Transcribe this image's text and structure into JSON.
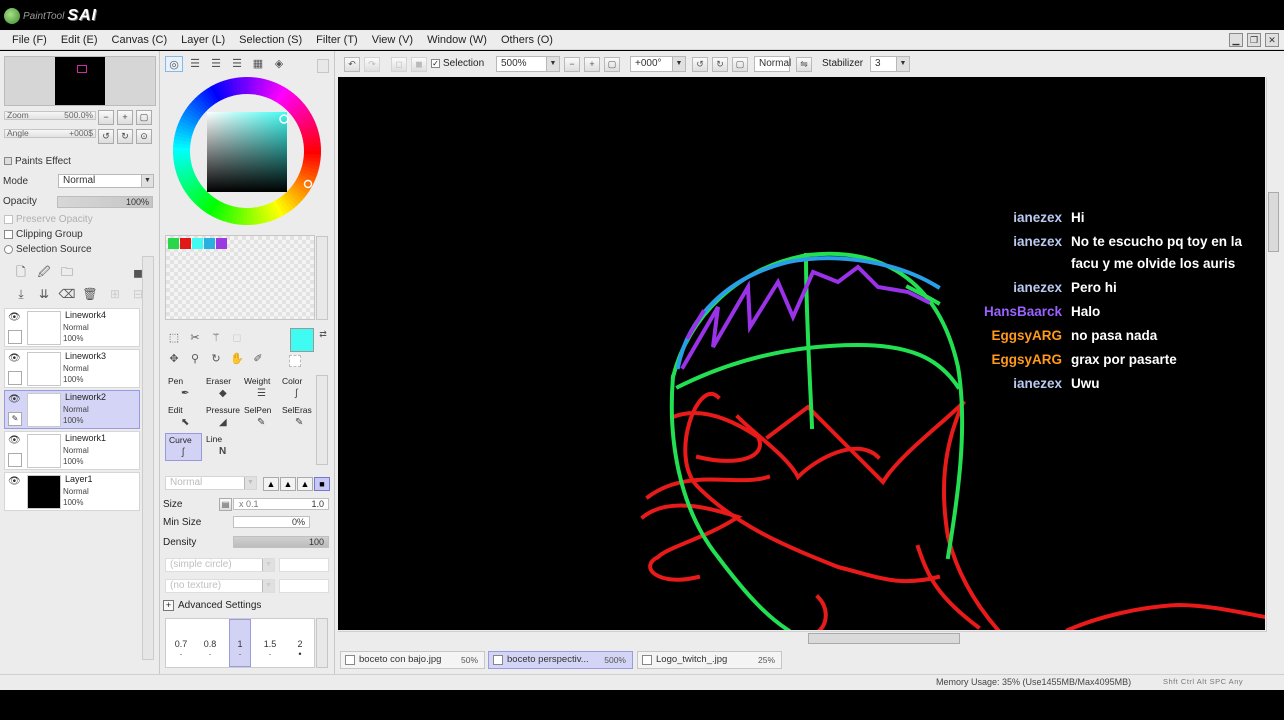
{
  "app": {
    "logo_small": "PaintTool",
    "logo_big": "SAI"
  },
  "menu": [
    {
      "label": "File (F)"
    },
    {
      "label": "Edit (E)"
    },
    {
      "label": "Canvas (C)"
    },
    {
      "label": "Layer (L)"
    },
    {
      "label": "Selection (S)"
    },
    {
      "label": "Filter (T)"
    },
    {
      "label": "View (V)"
    },
    {
      "label": "Window (W)"
    },
    {
      "label": "Others (O)"
    }
  ],
  "navigator": {
    "zoom_label": "Zoom",
    "zoom_value": "500.0%",
    "angle_label": "Angle",
    "angle_value": "+000$"
  },
  "layer_props": {
    "paints_effect": "Paints Effect",
    "mode_label": "Mode",
    "mode_value": "Normal",
    "opacity_label": "Opacity",
    "opacity_value": "100%",
    "preserve_opacity": "Preserve Opacity",
    "clipping_group": "Clipping Group",
    "selection_source": "Selection Source"
  },
  "layers": [
    {
      "name": "Linework4",
      "mode": "Normal",
      "opacity": "100%"
    },
    {
      "name": "Linework3",
      "mode": "Normal",
      "opacity": "100%"
    },
    {
      "name": "Linework2",
      "mode": "Normal",
      "opacity": "100%"
    },
    {
      "name": "Linework1",
      "mode": "Normal",
      "opacity": "100%"
    },
    {
      "name": "Layer1",
      "mode": "Normal",
      "opacity": "100%"
    }
  ],
  "colors": {
    "current": "#3ffbf2",
    "swatches": [
      "#2ad64a",
      "#e01818",
      "#3ffbf2",
      "#2ab0e0",
      "#9a3ae0"
    ],
    "line_green": "#22e052",
    "line_red": "#e81a1a",
    "line_purple": "#9a32e8",
    "line_blue": "#2a9ee8"
  },
  "tools": [
    {
      "label": "Pen"
    },
    {
      "label": "Eraser"
    },
    {
      "label": "Weight"
    },
    {
      "label": "Color"
    },
    {
      "label": "Edit"
    },
    {
      "label": "Pressure"
    },
    {
      "label": "SelPen"
    },
    {
      "label": "SelEras"
    },
    {
      "label": "Curve"
    },
    {
      "label": "Line"
    }
  ],
  "tool_props": {
    "blend_mode": "Normal",
    "size_label": "Size",
    "size_mult": "x 0.1",
    "size_value": "1.0",
    "minsize_label": "Min Size",
    "minsize_value": "0%",
    "density_label": "Density",
    "density_value": "100",
    "shape": "(simple circle)",
    "texture": "(no texture)",
    "advanced": "Advanced Settings",
    "sizes": [
      "0.7",
      "0.8",
      "1",
      "1.5",
      "2"
    ]
  },
  "canvas_toolbar": {
    "selection_label": "Selection",
    "zoom": "500%",
    "angle": "+000°",
    "blend": "Normal",
    "stabilizer_label": "Stabilizer",
    "stabilizer_value": "3"
  },
  "chat": [
    {
      "user": "ianezex",
      "color": "#b9c9f0",
      "message": "Hi"
    },
    {
      "user": "ianezex",
      "color": "#b9c9f0",
      "message": "No te escucho pq toy en la facu y me olvide los auris"
    },
    {
      "user": "ianezex",
      "color": "#b9c9f0",
      "message": "Pero hi"
    },
    {
      "user": "HansBaarck",
      "color": "#9a62ff",
      "message": "Halo"
    },
    {
      "user": "EggsyARG",
      "color": "#ff9a1a",
      "message": "no pasa nada"
    },
    {
      "user": "EggsyARG",
      "color": "#ff9a1a",
      "message": "grax por pasarte"
    },
    {
      "user": "ianezex",
      "color": "#b9c9f0",
      "message": "Uwu"
    }
  ],
  "doc_tabs": [
    {
      "name": "boceto con bajo.jpg",
      "zoom": "50%"
    },
    {
      "name": "boceto perspectiv...",
      "zoom": "500%"
    },
    {
      "name": "Logo_twitch_.jpg",
      "zoom": "25%"
    }
  ],
  "status": {
    "memory": "Memory Usage: 35% (Use1455MB/Max4095MB)",
    "keys": "Shft Ctrl Alt SPC Any"
  }
}
